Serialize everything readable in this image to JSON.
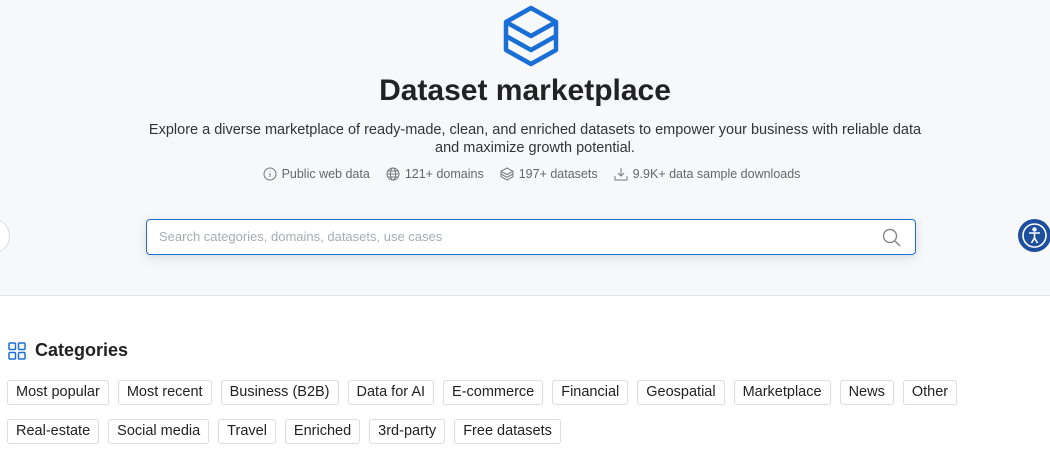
{
  "hero": {
    "title": "Dataset marketplace",
    "description": "Explore a diverse marketplace of ready-made, clean, and enriched datasets to empower your business with reliable data and maximize growth potential.",
    "stats": [
      {
        "icon": "info-icon",
        "label": "Public web data"
      },
      {
        "icon": "globe-icon",
        "label": "121+ domains"
      },
      {
        "icon": "layers-icon",
        "label": "197+ datasets"
      },
      {
        "icon": "download-icon",
        "label": "9.9K+ data sample downloads"
      }
    ],
    "search": {
      "placeholder": "Search categories, domains, datasets, use cases",
      "value": ""
    },
    "accent_color": "#1a6fd6"
  },
  "categories": {
    "heading": "Categories",
    "items": [
      "Most popular",
      "Most recent",
      "Business (B2B)",
      "Data for AI",
      "E-commerce",
      "Financial",
      "Geospatial",
      "Marketplace",
      "News",
      "Other",
      "Real-estate",
      "Social media",
      "Travel",
      "Enriched",
      "3rd-party",
      "Free datasets"
    ]
  }
}
